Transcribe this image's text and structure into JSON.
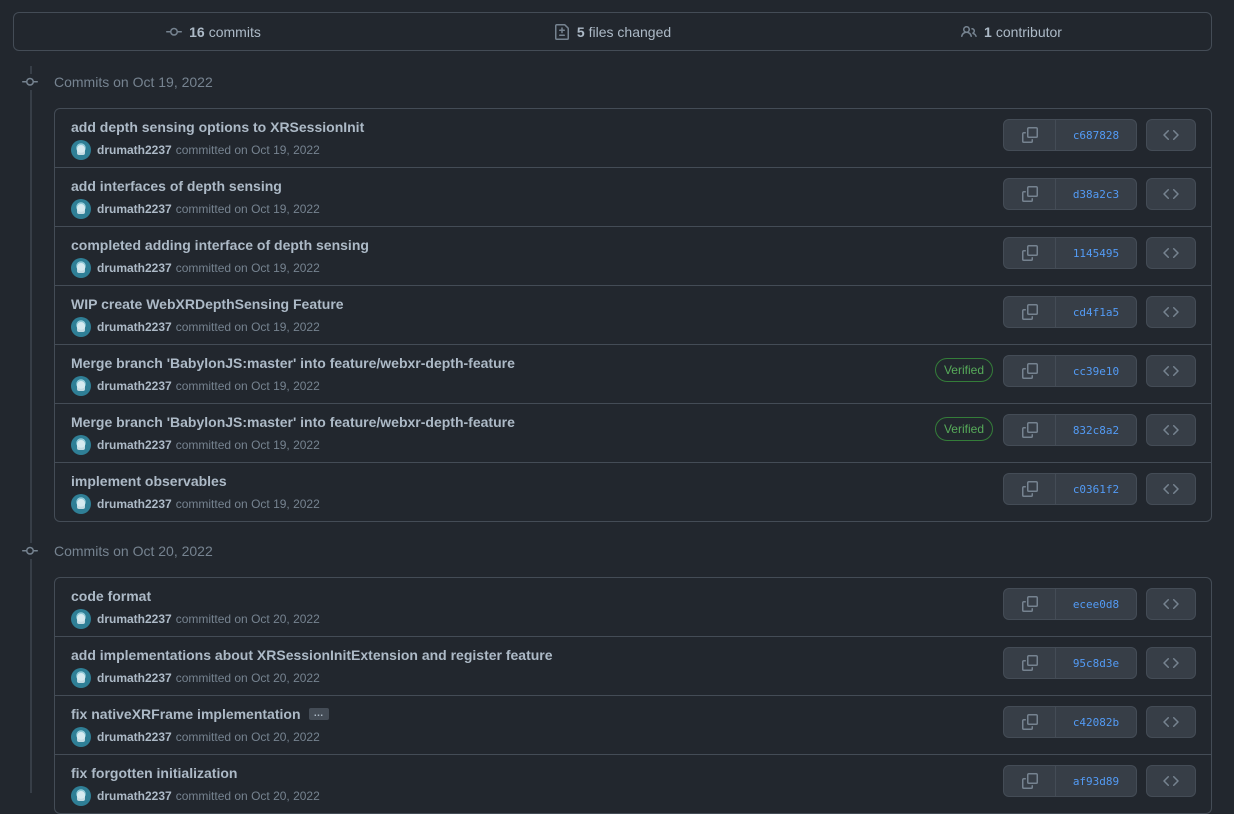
{
  "summary": {
    "commits_count": "16",
    "commits_label": "commits",
    "files_count": "5",
    "files_label": "files changed",
    "contributors_count": "1",
    "contributors_label": "contributor"
  },
  "groups": [
    {
      "label": "Commits on Oct 19, 2022",
      "commits": [
        {
          "title": "add depth sensing options to XRSessionInit",
          "author": "drumath2237",
          "meta": "committed on Oct 19, 2022",
          "sha": "c687828",
          "verified": false,
          "ellipsis": false
        },
        {
          "title": "add interfaces of depth sensing",
          "author": "drumath2237",
          "meta": "committed on Oct 19, 2022",
          "sha": "d38a2c3",
          "verified": false,
          "ellipsis": false
        },
        {
          "title": "completed adding interface of depth sensing",
          "author": "drumath2237",
          "meta": "committed on Oct 19, 2022",
          "sha": "1145495",
          "verified": false,
          "ellipsis": false
        },
        {
          "title": "WIP create WebXRDepthSensing Feature",
          "author": "drumath2237",
          "meta": "committed on Oct 19, 2022",
          "sha": "cd4f1a5",
          "verified": false,
          "ellipsis": false
        },
        {
          "title": "Merge branch 'BabylonJS:master' into feature/webxr-depth-feature",
          "author": "drumath2237",
          "meta": "committed on Oct 19, 2022",
          "sha": "cc39e10",
          "verified": true,
          "ellipsis": false
        },
        {
          "title": "Merge branch 'BabylonJS:master' into feature/webxr-depth-feature",
          "author": "drumath2237",
          "meta": "committed on Oct 19, 2022",
          "sha": "832c8a2",
          "verified": true,
          "ellipsis": false
        },
        {
          "title": "implement observables",
          "author": "drumath2237",
          "meta": "committed on Oct 19, 2022",
          "sha": "c0361f2",
          "verified": false,
          "ellipsis": false
        }
      ]
    },
    {
      "label": "Commits on Oct 20, 2022",
      "commits": [
        {
          "title": "code format",
          "author": "drumath2237",
          "meta": "committed on Oct 20, 2022",
          "sha": "ecee0d8",
          "verified": false,
          "ellipsis": false
        },
        {
          "title": "add implementations about XRSessionInitExtension and register feature",
          "author": "drumath2237",
          "meta": "committed on Oct 20, 2022",
          "sha": "95c8d3e",
          "verified": false,
          "ellipsis": false
        },
        {
          "title": "fix nativeXRFrame implementation",
          "author": "drumath2237",
          "meta": "committed on Oct 20, 2022",
          "sha": "c42082b",
          "verified": false,
          "ellipsis": true
        },
        {
          "title": "fix forgotten initialization",
          "author": "drumath2237",
          "meta": "committed on Oct 20, 2022",
          "sha": "af93d89",
          "verified": false,
          "ellipsis": false
        }
      ]
    }
  ],
  "verified_label": "Verified",
  "ellipsis_label": "…",
  "icons": {
    "commit": "git-commit-icon",
    "file_diff": "file-diff-icon",
    "people": "people-icon",
    "copy": "copy-icon",
    "browse": "code-icon"
  },
  "colors": {
    "background": "#22272e",
    "border": "#444c56",
    "text": "#adbac7",
    "muted": "#768390",
    "link": "#539bf5",
    "verified": "#57ab5a"
  }
}
